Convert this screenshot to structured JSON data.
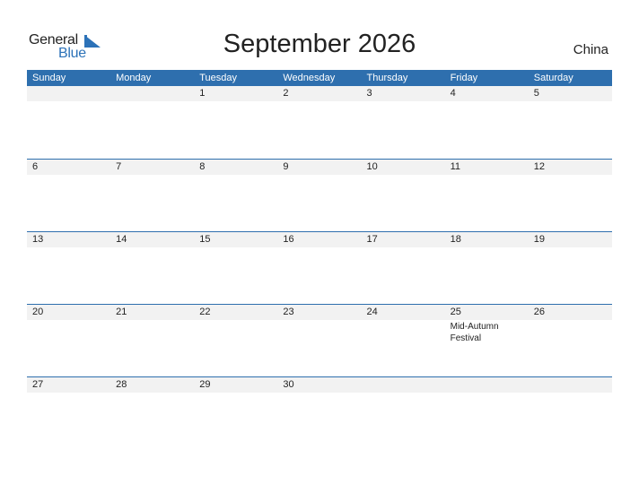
{
  "logo": {
    "line1": "General",
    "line2": "Blue"
  },
  "title": "September 2026",
  "country": "China",
  "colors": {
    "header_bg": "#2e6fae",
    "band_bg": "#f2f2f2",
    "brand_blue": "#2c72b8"
  },
  "weekdays": [
    "Sunday",
    "Monday",
    "Tuesday",
    "Wednesday",
    "Thursday",
    "Friday",
    "Saturday"
  ],
  "weeks": [
    {
      "days": [
        {
          "num": "",
          "event": ""
        },
        {
          "num": "",
          "event": ""
        },
        {
          "num": "1",
          "event": ""
        },
        {
          "num": "2",
          "event": ""
        },
        {
          "num": "3",
          "event": ""
        },
        {
          "num": "4",
          "event": ""
        },
        {
          "num": "5",
          "event": ""
        }
      ]
    },
    {
      "days": [
        {
          "num": "6",
          "event": ""
        },
        {
          "num": "7",
          "event": ""
        },
        {
          "num": "8",
          "event": ""
        },
        {
          "num": "9",
          "event": ""
        },
        {
          "num": "10",
          "event": ""
        },
        {
          "num": "11",
          "event": ""
        },
        {
          "num": "12",
          "event": ""
        }
      ]
    },
    {
      "days": [
        {
          "num": "13",
          "event": ""
        },
        {
          "num": "14",
          "event": ""
        },
        {
          "num": "15",
          "event": ""
        },
        {
          "num": "16",
          "event": ""
        },
        {
          "num": "17",
          "event": ""
        },
        {
          "num": "18",
          "event": ""
        },
        {
          "num": "19",
          "event": ""
        }
      ]
    },
    {
      "days": [
        {
          "num": "20",
          "event": ""
        },
        {
          "num": "21",
          "event": ""
        },
        {
          "num": "22",
          "event": ""
        },
        {
          "num": "23",
          "event": ""
        },
        {
          "num": "24",
          "event": ""
        },
        {
          "num": "25",
          "event": "Mid-Autumn Festival"
        },
        {
          "num": "26",
          "event": ""
        }
      ]
    },
    {
      "days": [
        {
          "num": "27",
          "event": ""
        },
        {
          "num": "28",
          "event": ""
        },
        {
          "num": "29",
          "event": ""
        },
        {
          "num": "30",
          "event": ""
        },
        {
          "num": "",
          "event": ""
        },
        {
          "num": "",
          "event": ""
        },
        {
          "num": "",
          "event": ""
        }
      ]
    }
  ]
}
